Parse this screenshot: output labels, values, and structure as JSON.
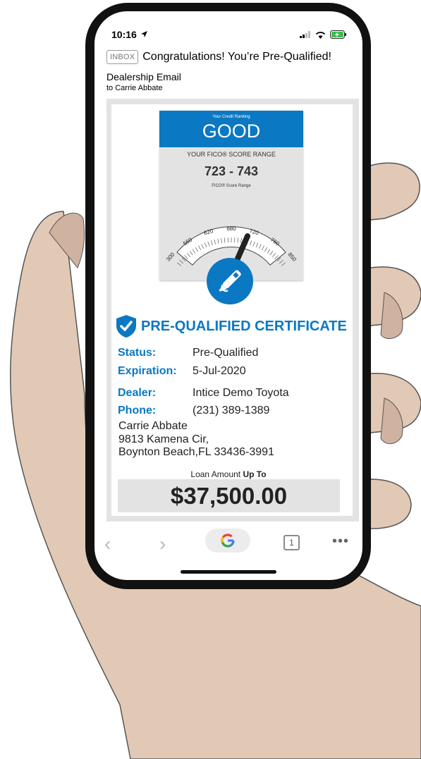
{
  "status_bar": {
    "time": "10:16",
    "location_icon": "location-arrow-icon",
    "signal_icon": "signal-icon",
    "wifi_icon": "wifi-icon",
    "battery_icon": "battery-charging-icon"
  },
  "email": {
    "tag": "INBOX",
    "subject": "Congratulations! You’re Pre-Qualified!",
    "sender": "Dealership Email",
    "recipient": "to Carrie Abbate"
  },
  "credit": {
    "ranking_caption": "Your Credit Ranking",
    "ranking": "GOOD",
    "range_title": "YOUR FICO® SCORE RANGE",
    "range": "723 - 743",
    "range_caption": "FICO® Score Range",
    "gauge_ticks": [
      "300",
      "560",
      "620",
      "680",
      "720",
      "760",
      "850"
    ],
    "badge_icon": "pen-icon"
  },
  "certificate": {
    "icon": "shield-check-icon",
    "title": "PRE-QUALIFIED CERTIFICATE",
    "fields": [
      {
        "label": "Status:",
        "value": "Pre-Qualified"
      },
      {
        "label": "Expiration:",
        "value": "5-Jul-2020"
      },
      {
        "label": "Dealer:",
        "value": "Intice Demo Toyota"
      },
      {
        "label": "Phone:",
        "value": "(231) 389-1389"
      }
    ],
    "address": [
      "Carrie Abbate",
      "9813 Kamena Cir,",
      "Boynton Beach,FL 33436-3991"
    ]
  },
  "loan": {
    "caption_prefix": "Loan Amount ",
    "caption_bold": "Up To",
    "amount": "$37,500.00"
  },
  "browser": {
    "back_icon": "chevron-left-icon",
    "forward_icon": "chevron-right-icon",
    "search_icon": "google-g-icon",
    "tabs_count": "1",
    "more_icon": "more-dots-icon"
  },
  "colors": {
    "accent": "#0a78c2",
    "panel": "#e3e3e3",
    "skin": "#e2c9b5"
  }
}
